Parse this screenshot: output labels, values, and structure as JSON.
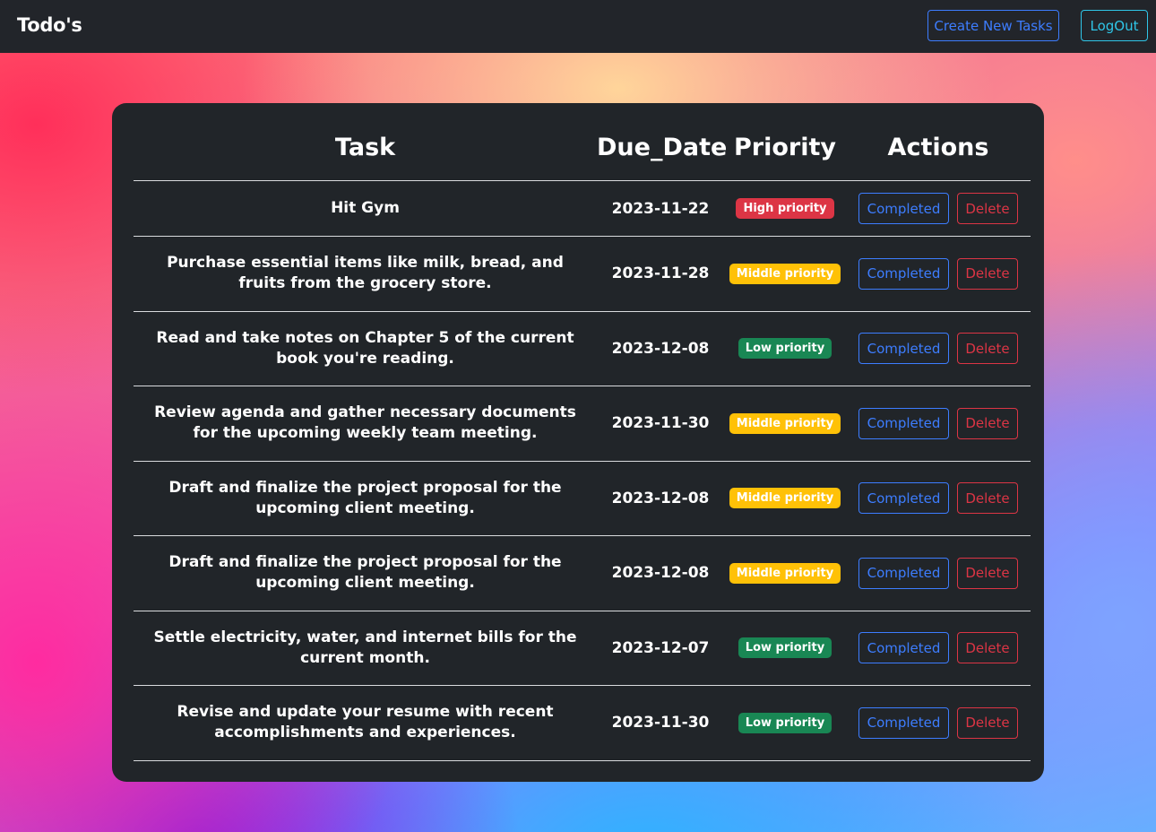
{
  "navbar": {
    "brand": "Todo's",
    "create_label": "Create New Tasks",
    "logout_label": "LogOut"
  },
  "table": {
    "headers": {
      "task": "Task",
      "due_date": "Due_Date",
      "priority": "Priority",
      "actions": "Actions"
    },
    "rows": [
      {
        "task": "Hit Gym",
        "due": "2023-11-22",
        "priority": "High priority",
        "level": "high",
        "completed": "Completed",
        "delete": "Delete"
      },
      {
        "task": "Purchase essential items like milk, bread, and fruits from the grocery store.",
        "due": "2023-11-28",
        "priority": "Middle priority",
        "level": "middle",
        "completed": "Completed",
        "delete": "Delete"
      },
      {
        "task": "Read and take notes on Chapter 5 of the current book you're reading.",
        "due": "2023-12-08",
        "priority": "Low priority",
        "level": "low",
        "completed": "Completed",
        "delete": "Delete"
      },
      {
        "task": "Review agenda and gather necessary documents for the upcoming weekly team meeting.",
        "due": "2023-11-30",
        "priority": "Middle priority",
        "level": "middle",
        "completed": "Completed",
        "delete": "Delete"
      },
      {
        "task": "Draft and finalize the project proposal for the upcoming client meeting.",
        "due": "2023-12-08",
        "priority": "Middle priority",
        "level": "middle",
        "completed": "Completed",
        "delete": "Delete"
      },
      {
        "task": "Draft and finalize the project proposal for the upcoming client meeting.",
        "due": "2023-12-08",
        "priority": "Middle priority",
        "level": "middle",
        "completed": "Completed",
        "delete": "Delete"
      },
      {
        "task": "Settle electricity, water, and internet bills for the current month.",
        "due": "2023-12-07",
        "priority": "Low priority",
        "level": "low",
        "completed": "Completed",
        "delete": "Delete"
      },
      {
        "task": "Revise and update your resume with recent accomplishments and experiences.",
        "due": "2023-11-30",
        "priority": "Low priority",
        "level": "low",
        "completed": "Completed",
        "delete": "Delete"
      }
    ]
  },
  "colors": {
    "high": "#dc3545",
    "middle": "#ffc107",
    "low": "#198754",
    "primary": "#3d7dff",
    "info": "#2fc6e8",
    "card": "#212529"
  }
}
